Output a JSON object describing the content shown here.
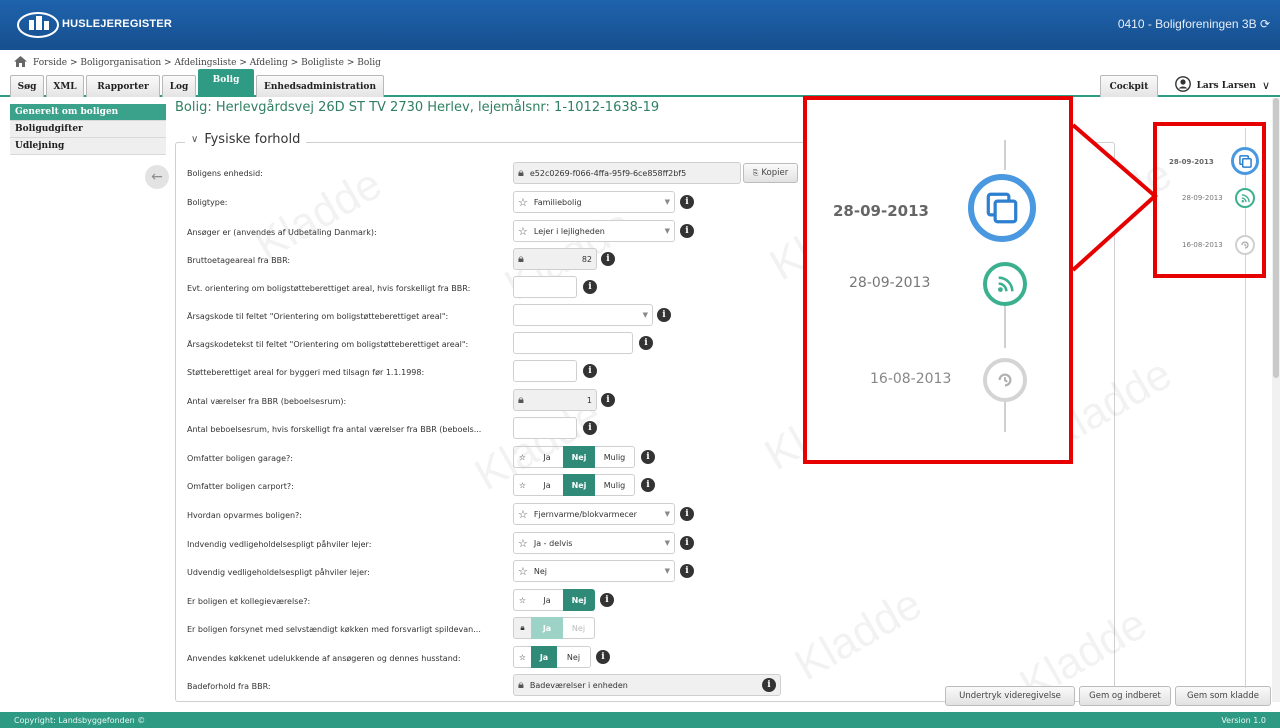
{
  "header": {
    "brand": "HUSLEJEREGISTER",
    "org": "0410 - Boligforeningen 3B"
  },
  "breadcrumb": [
    "Forside",
    "Boligorganisation",
    "Afdelingsliste",
    "Afdeling",
    "Boligliste",
    "Bolig"
  ],
  "breadcrumb_sep": ">",
  "tabs": {
    "sog": "Søg",
    "xml": "XML",
    "rapporter": "Rapporter",
    "log": "Log",
    "bolig": "Bolig",
    "enheds": "Enhedsadministration",
    "cockpit": "Cockpit"
  },
  "user": {
    "name": "Lars Larsen"
  },
  "leftnav": {
    "items": [
      "Generelt om boligen",
      "Boligudgifter",
      "Udlejning"
    ]
  },
  "page": {
    "title": "Bolig: Herlevgårdsvej 26D ST TV 2730 Herlev, lejemålsnr: 1-1012-1638-19"
  },
  "section": {
    "legend": "Fysiske forhold"
  },
  "watermark": "Kladde",
  "form": {
    "enhedsid_label": "Boligens enhedsid:",
    "enhedsid_value": "e52c0269-f066-4ffa-95f9-6ce858ff2bf5",
    "kopier": "Kopier",
    "boligtype_label": "Boligtype:",
    "boligtype_value": "Familiebolig",
    "ansoger_label": "Ansøger er (anvendes af Udbetaling Danmark):",
    "ansoger_value": "Lejer i lejligheden",
    "brutto_label": "Bruttoetageareal fra BBR:",
    "brutto_value": "82",
    "evt_label": "Evt. orientering om boligstøtteberettiget areal, hvis forskelligt fra BBR:",
    "aarsagskode_label": "Årsagskode til feltet \"Orientering om boligstøtteberettiget areal\":",
    "aarsagstekst_label": "Årsagskodetekst til feltet \"Orientering om boligstøtteberettiget areal\":",
    "stotte_label": "Støtteberettiget areal for byggeri med tilsagn før 1.1.1998:",
    "vaerelser_label": "Antal værelser fra BBR (beboelsesrum):",
    "vaerelser_value": "1",
    "beboelsesrum_label": "Antal beboelsesrum, hvis forskelligt fra antal værelser fra BBR (beboels...",
    "garage_label": "Omfatter boligen garage?:",
    "carport_label": "Omfatter boligen carport?:",
    "opvarmes_label": "Hvordan opvarmes boligen?:",
    "opvarmes_value": "Fjernvarme/blokvarmecer",
    "indvendig_label": "Indvendig vedligeholdelsespligt påhviler lejer:",
    "indvendig_value": "Ja - delvis",
    "udvendig_label": "Udvendig vedligeholdelsespligt påhviler lejer:",
    "udvendig_value": "Nej",
    "kollegie_label": "Er boligen et kollegieværelse?:",
    "kokken_label": "Er boligen forsynet med selvstændigt køkken med forsvarligt spildevan...",
    "anvendes_label": "Anvendes køkkenet udelukkende af ansøgeren og dennes husstand:",
    "bad_label": "Badeforhold fra BBR:",
    "bad_value": "Badeværelser i enheden",
    "opt_ja": "Ja",
    "opt_nej": "Nej",
    "opt_mulig": "Mulig"
  },
  "buttons": {
    "undertryk": "Undertryk videregivelse",
    "indberet": "Gem og indberet",
    "kladde": "Gem som kladde"
  },
  "timeline": {
    "dates": [
      "28-09-2013",
      "28-09-2013",
      "16-08-2013"
    ]
  },
  "footer": {
    "copyright": "Copyright: Landsbyggefonden ©",
    "version": "Version 1.0"
  },
  "colors": {
    "header": "#1f63ad",
    "accent": "#2f9b84",
    "highlight": "#e60000",
    "blue_icon": "#4a98e0",
    "green_icon": "#3bb08f"
  }
}
